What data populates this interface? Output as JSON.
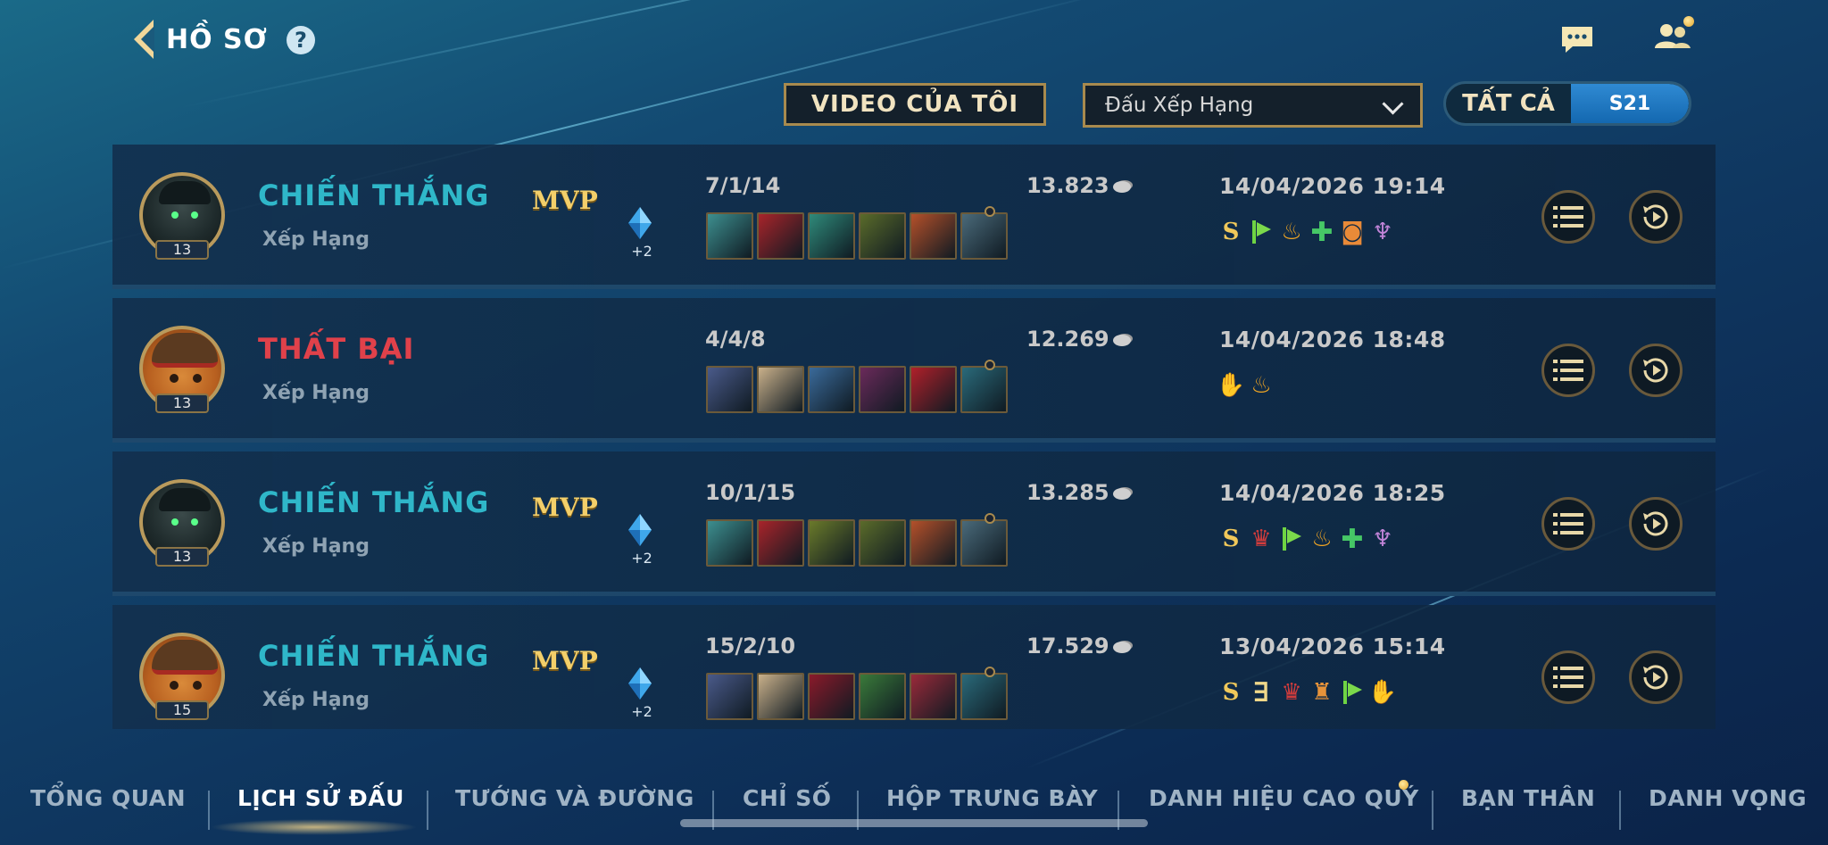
{
  "header": {
    "title": "HỒ SƠ",
    "help_label": "?"
  },
  "filters": {
    "video_button": "VIDEO CỦA TÔI",
    "mode_select": "Đấu Xếp Hạng",
    "season_all": "TẤT CẢ",
    "season_current": "S21"
  },
  "matches": [
    {
      "result": "CHIẾN THẮNG",
      "outcome": "win",
      "mode": "Xếp Hạng",
      "level": "13",
      "mvp": "MVP",
      "gem_count": "+2",
      "kda": "7/1/14",
      "gold": "13.823",
      "datetime": "14/04/2026 19:14",
      "badges": [
        "S",
        "flag",
        "fire",
        "heal",
        "orange",
        "wings"
      ],
      "items": [
        "#3d8f8f",
        "#a8242a",
        "#2f8a7a",
        "#5a6b2a",
        "#b4502a",
        "#4a6a7a"
      ]
    },
    {
      "result": "THẤT BẠI",
      "outcome": "loss",
      "mode": "Xếp Hạng",
      "level": "13",
      "mvp": "",
      "gem_count": "",
      "kda": "4/4/8",
      "gold": "12.269",
      "datetime": "14/04/2026 18:48",
      "badges": [
        "hand",
        "fire"
      ],
      "items": [
        "#4a5a8a",
        "#c9b08a",
        "#3a6a9a",
        "#6a2a5a",
        "#b0202a",
        "#2a6a7a"
      ]
    },
    {
      "result": "CHIẾN THẮNG",
      "outcome": "win",
      "mode": "Xếp Hạng",
      "level": "13",
      "mvp": "MVP",
      "gem_count": "+2",
      "kda": "10/1/15",
      "gold": "13.285",
      "datetime": "14/04/2026 18:25",
      "badges": [
        "S",
        "red",
        "flag",
        "fire",
        "heal",
        "wings"
      ],
      "items": [
        "#3d8f8f",
        "#a8242a",
        "#6a7a2a",
        "#5a6b2a",
        "#b4502a",
        "#4a6a7a"
      ]
    },
    {
      "result": "CHIẾN THẮNG",
      "outcome": "win",
      "mode": "Xếp Hạng",
      "level": "15",
      "mvp": "MVP",
      "gem_count": "+2",
      "kda": "15/2/10",
      "gold": "17.529",
      "datetime": "13/04/2026 15:14",
      "badges": [
        "S",
        "triple",
        "red",
        "shield",
        "flag",
        "hand"
      ],
      "items": [
        "#4a5a8a",
        "#c9b08a",
        "#8a1a2a",
        "#3a7a3a",
        "#9a2a3a",
        "#2a6a7a"
      ]
    }
  ],
  "tabs": [
    {
      "label": "TỔNG QUAN"
    },
    {
      "label": "LỊCH SỬ ĐẤU"
    },
    {
      "label": "TƯỚNG VÀ ĐƯỜNG"
    },
    {
      "label": "CHỈ SỐ"
    },
    {
      "label": "HỘP TRƯNG BÀY"
    },
    {
      "label": "DANH HIỆU CAO QUÝ"
    },
    {
      "label": "BẠN THÂN"
    },
    {
      "label": "DANH VỌNG"
    }
  ],
  "active_tab": "LỊCH SỬ ĐẤU",
  "colors": {
    "win": "#2fb7c9",
    "loss": "#e0414a",
    "gold_accent": "#a88a4e",
    "mvp": "#f3cf6a"
  }
}
